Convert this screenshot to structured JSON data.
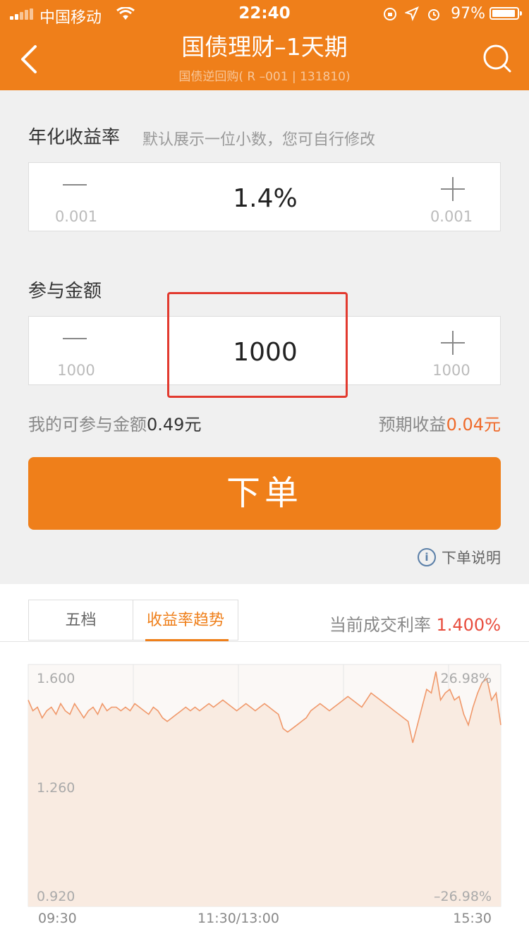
{
  "status_bar": {
    "carrier": "中国移动",
    "time": "22:40",
    "battery": "97%"
  },
  "header": {
    "title": "国债理财–1天期",
    "subtitle": "国债逆回购( R –001 | 131810)"
  },
  "rate_section": {
    "label": "年化收益率",
    "hint": "默认展示一位小数，您可自行修改",
    "value": "1.4%",
    "step_minus": "0.001",
    "step_plus": "0.001"
  },
  "amount_section": {
    "label": "参与金额",
    "value": "1000",
    "step_minus": "1000",
    "step_plus": "1000"
  },
  "summary": {
    "available_label": "我的可参与金额",
    "available_value": "0.49元",
    "expected_label": "预期收益",
    "expected_value": "0.04元"
  },
  "order_button": "下单",
  "order_explain": "下单说明",
  "tabs": [
    "五档",
    "收益率趋势"
  ],
  "current_rate": {
    "label": "当前成交利率",
    "value": "1.400%"
  },
  "colors": {
    "brand": "#ef7f1a",
    "highlight": "#e23a2f",
    "rate_red": "#e84c3d",
    "line": "#f0986a"
  },
  "chart_data": {
    "type": "line",
    "ylim": [
      0.92,
      1.6
    ],
    "y_ticks_left": [
      "1.600",
      "1.260",
      "0.920"
    ],
    "y_ticks_right": [
      "26.98%",
      "–26.98%"
    ],
    "x_ticks": [
      "09:30",
      "11:30/13:00",
      "15:30"
    ],
    "values": [
      1.5,
      1.47,
      1.48,
      1.45,
      1.47,
      1.48,
      1.46,
      1.49,
      1.47,
      1.46,
      1.49,
      1.47,
      1.45,
      1.47,
      1.48,
      1.46,
      1.49,
      1.47,
      1.48,
      1.48,
      1.47,
      1.48,
      1.47,
      1.49,
      1.48,
      1.47,
      1.46,
      1.48,
      1.47,
      1.45,
      1.44,
      1.45,
      1.46,
      1.47,
      1.48,
      1.47,
      1.48,
      1.47,
      1.48,
      1.49,
      1.48,
      1.49,
      1.5,
      1.49,
      1.48,
      1.47,
      1.48,
      1.49,
      1.48,
      1.47,
      1.48,
      1.49,
      1.48,
      1.47,
      1.46,
      1.42,
      1.41,
      1.42,
      1.43,
      1.44,
      1.45,
      1.47,
      1.48,
      1.49,
      1.48,
      1.47,
      1.48,
      1.49,
      1.5,
      1.51,
      1.5,
      1.49,
      1.48,
      1.5,
      1.52,
      1.51,
      1.5,
      1.49,
      1.48,
      1.47,
      1.46,
      1.45,
      1.44,
      1.38,
      1.43,
      1.48,
      1.53,
      1.52,
      1.58,
      1.5,
      1.52,
      1.53,
      1.5,
      1.51,
      1.46,
      1.43,
      1.48,
      1.52,
      1.55,
      1.56,
      1.5,
      1.52,
      1.43
    ]
  }
}
